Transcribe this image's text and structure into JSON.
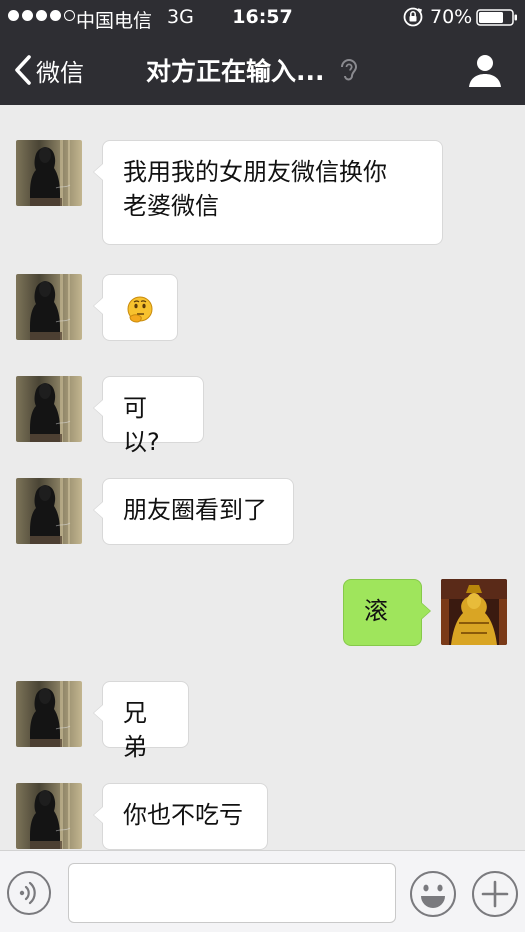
{
  "status_bar": {
    "carrier": "中国电信",
    "network": "3G",
    "time": "16:57",
    "battery": "70%"
  },
  "nav": {
    "back_label": "微信",
    "title": "对方正在输入..."
  },
  "messages": [
    {
      "side": "left",
      "text_lines": [
        "我用我的女朋友微信换你",
        "老婆微信"
      ]
    },
    {
      "side": "left",
      "emoji": "thinking-face-emoji"
    },
    {
      "side": "left",
      "text": "可以?"
    },
    {
      "side": "left",
      "text": "朋友圈看到了"
    },
    {
      "side": "right",
      "text": "滚"
    },
    {
      "side": "left",
      "text": "兄弟"
    },
    {
      "side": "left",
      "text": "你也不吃亏"
    }
  ],
  "input": {
    "value": "",
    "placeholder": ""
  },
  "colors": {
    "bar_background": "#2e2e33",
    "chat_background": "#ebebeb",
    "outgoing_bubble": "#9fe55c",
    "incoming_bubble": "#ffffff"
  }
}
